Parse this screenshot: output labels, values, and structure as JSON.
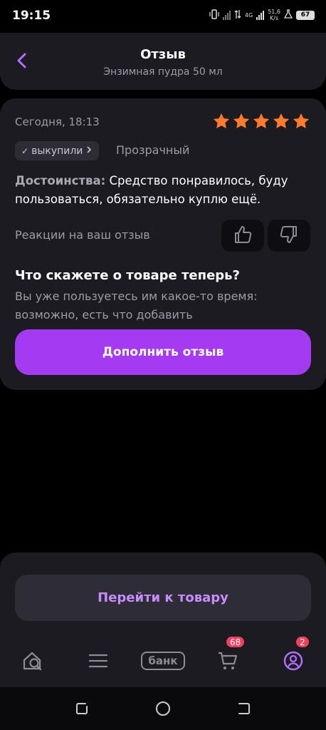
{
  "status_bar": {
    "time": "19:15",
    "network": "4G",
    "speed_value": "51,6",
    "speed_unit": "K/s",
    "battery": "67"
  },
  "header": {
    "title": "Отзыв",
    "subtitle": "Энзимная пудра 50 мл"
  },
  "review": {
    "date": "Сегодня, 18:13",
    "rating": 5,
    "star_color": "#ff7a2a",
    "badge_label": "выкупили",
    "variant": "Прозрачный",
    "pros_label": "Достоинства:",
    "pros_text": "Средство понравилось, буду пользоваться, обязательно куплю ещё.",
    "reactions_label": "Реакции на ваш отзыв"
  },
  "prompt": {
    "title": "Что скажете о товаре теперь?",
    "text": "Вы уже пользуетесь им какое-то время: возможно, есть что добавить",
    "button_label": "Дополнить отзыв",
    "accent_color": "#a43bf2"
  },
  "bottom": {
    "goto_label": "Перейти к товару"
  },
  "tab_bar": {
    "bank_label": "банк",
    "cart_count": "68",
    "profile_count": "2"
  }
}
